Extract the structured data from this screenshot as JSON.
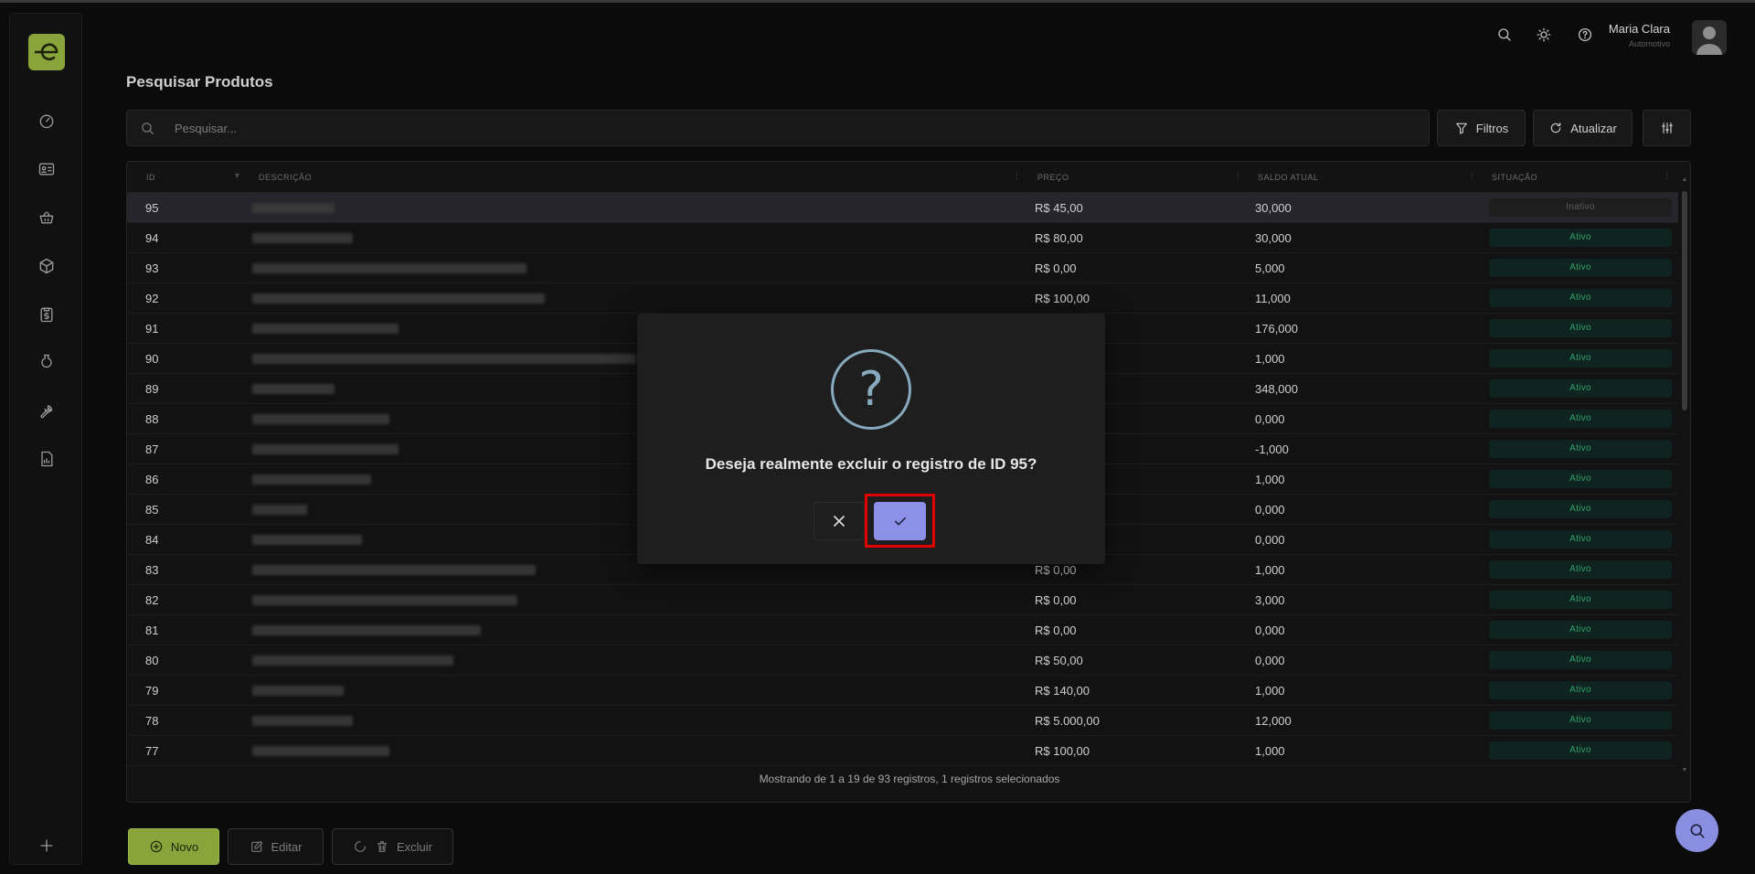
{
  "header": {
    "user_name": "Maria Clara",
    "user_role": "Automotivo",
    "page_title": "Pesquisar Produtos"
  },
  "search": {
    "placeholder": "Pesquisar..."
  },
  "toolbar": {
    "filters_label": "Filtros",
    "refresh_label": "Atualizar"
  },
  "table": {
    "columns": [
      "ID",
      "DESCRIÇÃO",
      "PREÇO",
      "SALDO ATUAL",
      "SITUAÇÃO"
    ],
    "rows": [
      {
        "id": "95",
        "price": "R$ 45,00",
        "balance": "30,000",
        "status": "Inativo",
        "selected": true
      },
      {
        "id": "94",
        "price": "R$ 80,00",
        "balance": "30,000",
        "status": "Ativo"
      },
      {
        "id": "93",
        "price": "R$ 0,00",
        "balance": "5,000",
        "status": "Ativo"
      },
      {
        "id": "92",
        "price": "R$ 100,00",
        "balance": "11,000",
        "status": "Ativo"
      },
      {
        "id": "91",
        "price": "",
        "balance": "176,000",
        "status": "Ativo"
      },
      {
        "id": "90",
        "price": "",
        "balance": "1,000",
        "status": "Ativo"
      },
      {
        "id": "89",
        "price": "",
        "balance": "348,000",
        "status": "Ativo"
      },
      {
        "id": "88",
        "price": "",
        "balance": "0,000",
        "status": "Ativo"
      },
      {
        "id": "87",
        "price": "",
        "balance": "-1,000",
        "status": "Ativo"
      },
      {
        "id": "86",
        "price": "",
        "balance": "1,000",
        "status": "Ativo"
      },
      {
        "id": "85",
        "price": "",
        "balance": "0,000",
        "status": "Ativo"
      },
      {
        "id": "84",
        "price": "",
        "balance": "0,000",
        "status": "Ativo"
      },
      {
        "id": "83",
        "price": "R$ 0,00",
        "balance": "1,000",
        "status": "Ativo"
      },
      {
        "id": "82",
        "price": "R$ 0,00",
        "balance": "3,000",
        "status": "Ativo"
      },
      {
        "id": "81",
        "price": "R$ 0,00",
        "balance": "0,000",
        "status": "Ativo"
      },
      {
        "id": "80",
        "price": "R$ 50,00",
        "balance": "0,000",
        "status": "Ativo"
      },
      {
        "id": "79",
        "price": "R$ 140,00",
        "balance": "1,000",
        "status": "Ativo"
      },
      {
        "id": "78",
        "price": "R$ 5.000,00",
        "balance": "12,000",
        "status": "Ativo"
      },
      {
        "id": "77",
        "price": "R$ 100,00",
        "balance": "1,000",
        "status": "Ativo"
      }
    ],
    "footer": "Mostrando de 1 a 19 de 93 registros, 1 registros selecionados"
  },
  "actions": {
    "new_label": "Novo",
    "edit_label": "Editar",
    "delete_label": "Excluir"
  },
  "modal": {
    "icon": "?",
    "message": "Deseja realmente excluir o registro de ID 95?"
  },
  "colors": {
    "brand": "#8aa43c",
    "accent": "#8c90e6",
    "active": "#2fa36a",
    "highlight": "#e00000"
  },
  "icons": {
    "sidebar": [
      "dashboard-icon",
      "id-card-icon",
      "basket-icon",
      "box-icon",
      "clipboard-dollar-icon",
      "jar-icon",
      "wrench-icon",
      "report-icon",
      "plus-icon"
    ],
    "header": [
      "search-icon",
      "sun-icon",
      "help-icon"
    ]
  }
}
